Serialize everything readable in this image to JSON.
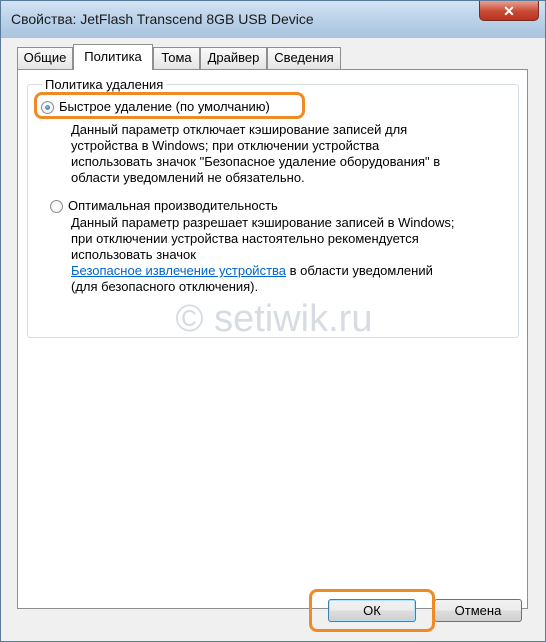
{
  "window": {
    "title": "Свойства: JetFlash Transcend 8GB USB Device",
    "close_glyph": "✕"
  },
  "tabs": [
    {
      "label": "Общие",
      "active": false
    },
    {
      "label": "Политика",
      "active": true
    },
    {
      "label": "Тома",
      "active": false
    },
    {
      "label": "Драйвер",
      "active": false
    },
    {
      "label": "Сведения",
      "active": false
    }
  ],
  "policy_group": {
    "title": "Политика удаления",
    "quick": {
      "label": "Быстрое удаление (по умолчанию)",
      "selected": true,
      "description": [
        "Данный параметр отключает кэширование записей для",
        "устройства в Windows; при отключении устройства",
        "использовать значок \"Безопасное удаление оборудования\" в",
        "области уведомлений не обязательно."
      ]
    },
    "optimal": {
      "label": "Оптимальная производительность",
      "selected": false,
      "description": [
        "Данный параметр разрешает кэширование записей в Windows;",
        "при отключении устройства настоятельно рекомендуется",
        "использовать значок"
      ],
      "link_text": "Безопасное извлечение устройства",
      "link_suffix": " в области уведомлений",
      "last_line": "(для безопасного отключения)."
    }
  },
  "watermark": "© setiwik.ru",
  "buttons": {
    "ok": "ОК",
    "cancel": "Отмена"
  },
  "colors": {
    "highlight": "#f08a24",
    "link": "#0066cc",
    "close_button": "#c84a34"
  }
}
